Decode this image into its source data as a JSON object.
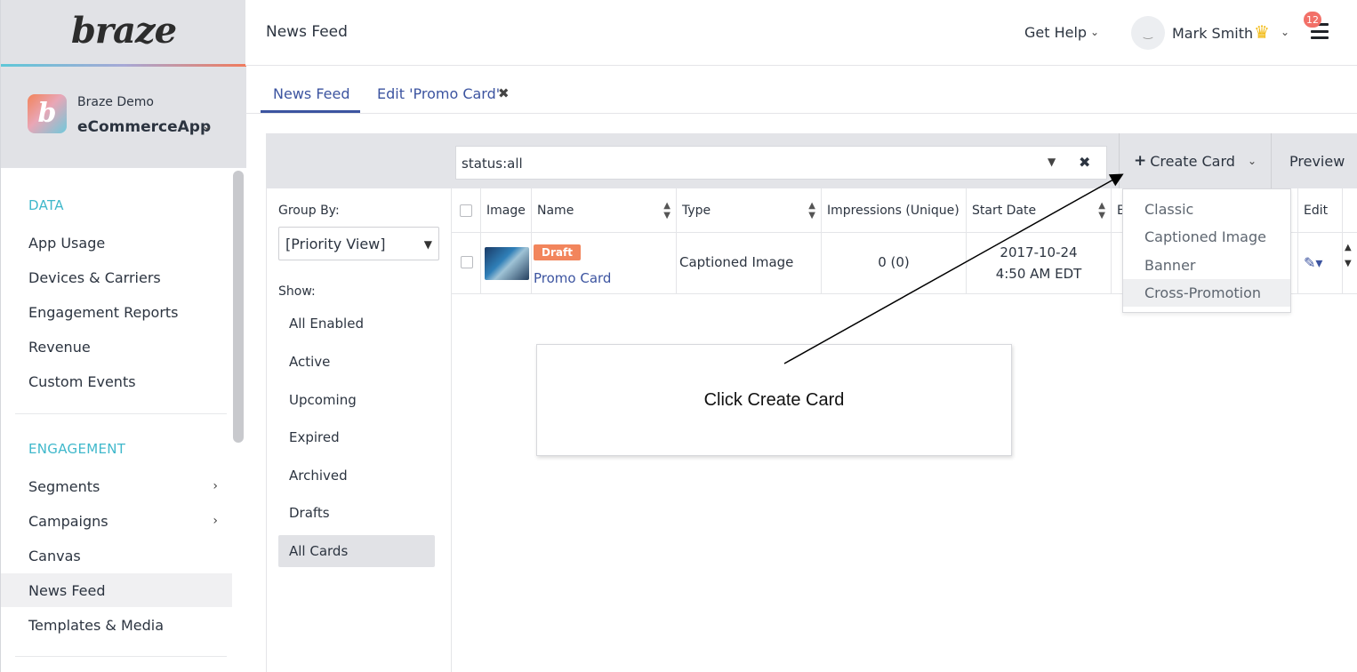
{
  "brand": {
    "logo_text": "braze",
    "accent_gradient": [
      "#5ec7d8",
      "#a6a8d6",
      "#f07a5c"
    ]
  },
  "app_switcher": {
    "company": "Braze Demo",
    "app_name": "eCommerceApp"
  },
  "sidebar": {
    "sections": [
      {
        "title": "DATA",
        "items": [
          {
            "label": "App Usage"
          },
          {
            "label": "Devices & Carriers"
          },
          {
            "label": "Engagement Reports"
          },
          {
            "label": "Revenue"
          },
          {
            "label": "Custom Events"
          }
        ]
      },
      {
        "title": "ENGAGEMENT",
        "items": [
          {
            "label": "Segments",
            "has_submenu": true
          },
          {
            "label": "Campaigns",
            "has_submenu": true
          },
          {
            "label": "Canvas"
          },
          {
            "label": "News Feed",
            "active": true
          },
          {
            "label": "Templates & Media"
          }
        ]
      }
    ]
  },
  "header": {
    "page_title": "News Feed",
    "help_label": "Get Help",
    "user_name": "Mark Smith",
    "notification_count": "12"
  },
  "tabs": [
    {
      "label": "News Feed",
      "active": true
    },
    {
      "label": "Edit 'Promo Card'",
      "closable": true
    }
  ],
  "toolbar": {
    "filter_value": "status:all",
    "create_label": "Create Card",
    "preview_label": "Preview"
  },
  "filters": {
    "group_by_label": "Group By:",
    "group_by_value": "[Priority View]",
    "show_label": "Show:",
    "show_options": [
      "All Enabled",
      "Active",
      "Upcoming",
      "Expired",
      "Archived",
      "Drafts",
      "All Cards"
    ],
    "selected": "All Cards"
  },
  "table": {
    "columns": [
      "Image",
      "Name",
      "Type",
      "Impressions (Unique)",
      "Start Date",
      "E",
      "Edit"
    ],
    "rows": [
      {
        "status_badge": "Draft",
        "name": "Promo Card",
        "type": "Captioned Image",
        "impressions": "0 (0)",
        "start_date_line1": "2017-10-24",
        "start_date_line2": "4:50 AM EDT"
      }
    ]
  },
  "create_menu": {
    "options": [
      "Classic",
      "Captioned Image",
      "Banner",
      "Cross-Promotion"
    ],
    "hovered": "Cross-Promotion"
  },
  "annotation": {
    "text": "Click Create Card"
  },
  "colors": {
    "link": "#3c54a0",
    "section_title": "#3fb8cb",
    "draft_badge": "#f2855c",
    "notification": "#f27068",
    "crown": "#f2b90f"
  }
}
